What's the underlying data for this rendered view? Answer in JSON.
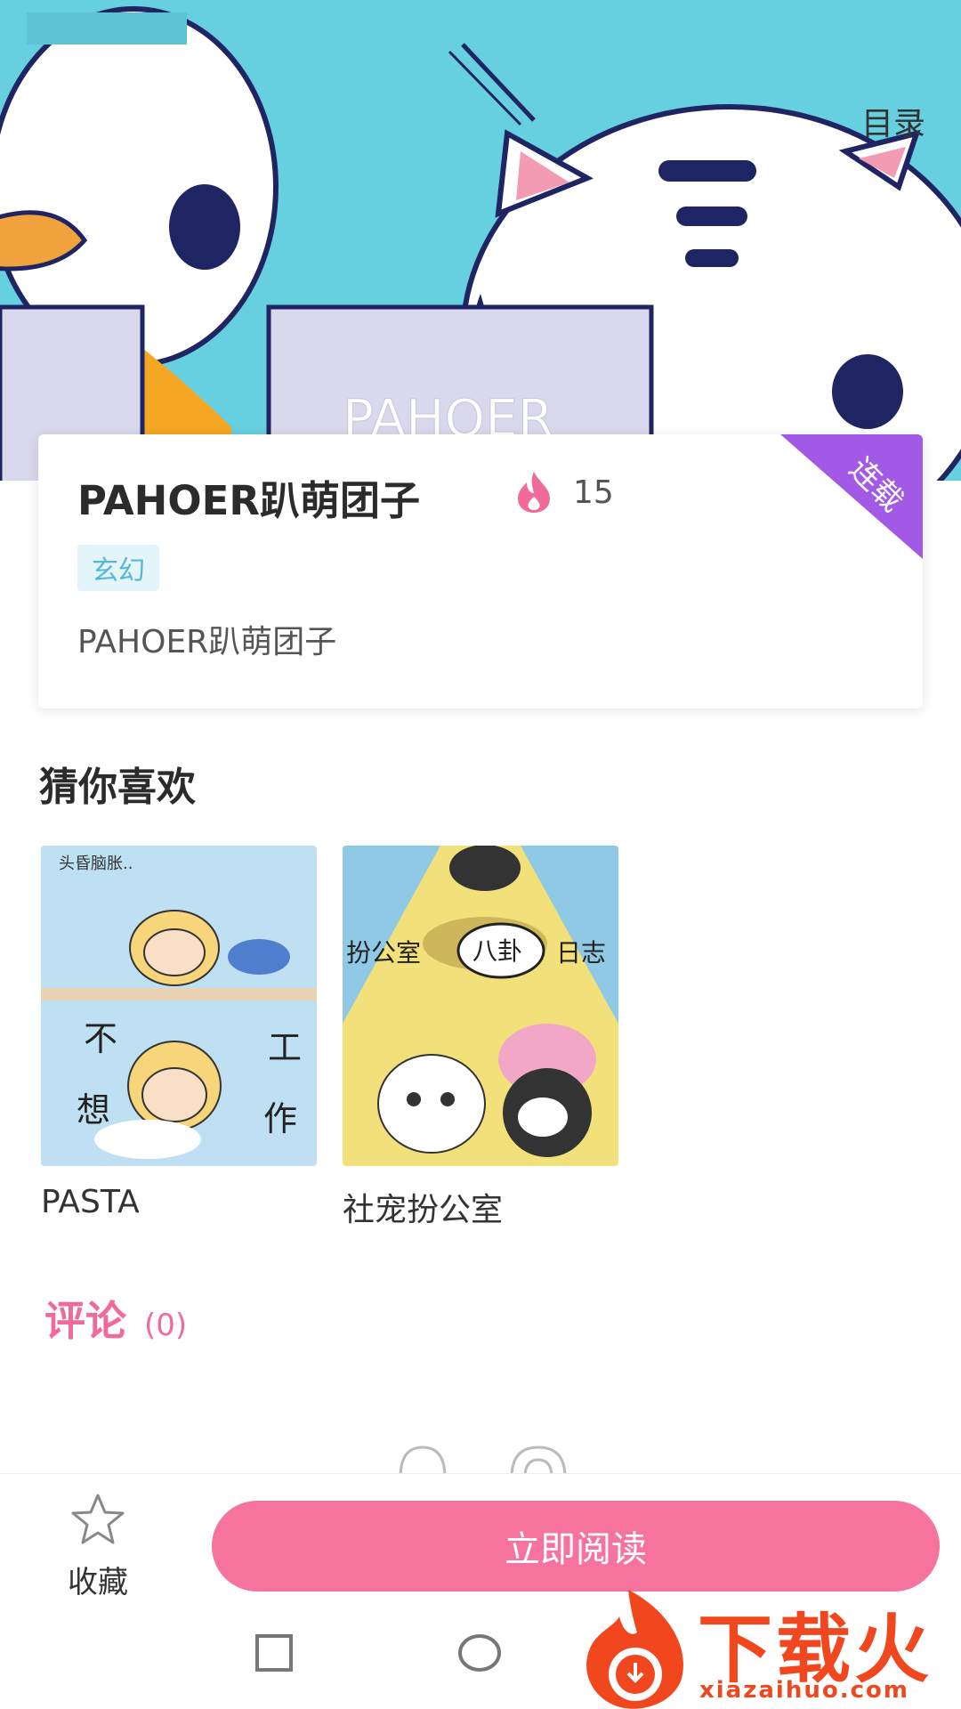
{
  "header": {
    "back_icon": "chevron-left-icon",
    "catalog_label": "目录",
    "banner_text": "PAHOER"
  },
  "comic": {
    "title": "PAHOER趴萌团子",
    "hot_icon": "flame-icon",
    "hot_count": "15",
    "genre_tag": "玄幻",
    "description": "PAHOER趴萌团子",
    "status_badge": "连载",
    "colors": {
      "badge": "#a25ae6",
      "tag_bg": "#e4f5fa",
      "tag_text": "#55b8d8",
      "flame": "#f06a9a"
    }
  },
  "recommend": {
    "title": "猜你喜欢",
    "items": [
      {
        "name": "PASTA",
        "cover_texts": [
          "头昏脑胀..",
          "不",
          "想",
          "工",
          "作"
        ]
      },
      {
        "name": "社宠扮公室",
        "cover_texts": [
          "扮公室",
          "八卦",
          "日志"
        ]
      }
    ]
  },
  "comments": {
    "label": "评论",
    "count": "(0)",
    "color": "#f06a9a"
  },
  "bottom_bar": {
    "favorite_label": "收藏",
    "favorite_icon": "star-icon",
    "read_label": "立即阅读",
    "read_color": "#f5739d"
  },
  "system_nav": {
    "icons": [
      "recent-apps-icon",
      "home-icon",
      "back-icon"
    ]
  },
  "watermark": {
    "text": "下载火",
    "url": "xiazaihuo.com",
    "color": "#f0471f"
  }
}
